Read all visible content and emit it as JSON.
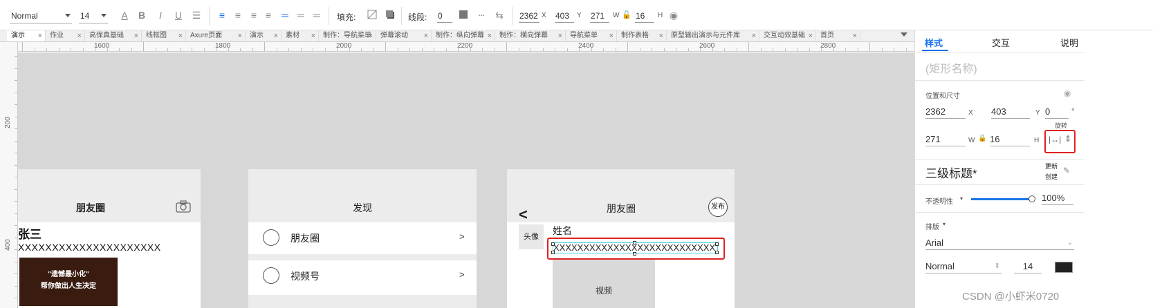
{
  "toolbar": {
    "style_value": "Normal",
    "font_size_value": "14",
    "fill_label": "填充:",
    "stroke_label": "线段:",
    "stroke_value": "0",
    "x_value": "2362",
    "x_unit": "X",
    "y_value": "403",
    "y_unit": "Y",
    "w_value": "271",
    "w_unit": "W",
    "h_value": "16",
    "h_unit": "H"
  },
  "tabs": [
    {
      "label": "演示",
      "active": true
    },
    {
      "label": "作业"
    },
    {
      "label": "高保真基础"
    },
    {
      "label": "线框图"
    },
    {
      "label": "Axure页面"
    },
    {
      "label": "演示"
    },
    {
      "label": "素材"
    },
    {
      "label": "制作：导航菜单"
    },
    {
      "label": "弹幕滚动"
    },
    {
      "label": "制作：纵向弹幕"
    },
    {
      "label": "制作：横向弹幕"
    },
    {
      "label": "导航菜单"
    },
    {
      "label": "制作表格"
    },
    {
      "label": "原型输出演示与元件库"
    },
    {
      "label": "交互动效基础"
    },
    {
      "label": "首页"
    }
  ],
  "ruler": {
    "h_labels": [
      "1600",
      "1800",
      "2000",
      "2200",
      "2400",
      "2600",
      "2800"
    ],
    "v_labels": [
      "200",
      "400"
    ]
  },
  "canvas": {
    "phone1": {
      "title": "朋友圈",
      "name": "张三",
      "text": "XXXXXXXXXXXXXXXXXXXXX",
      "img_line1": "\"遗憾最小化\"",
      "img_line2": "帮你做出人生决定"
    },
    "phone2": {
      "title": "发现",
      "items": [
        {
          "label": "朋友圈",
          "arrow": ">"
        },
        {
          "label": "视频号",
          "arrow": ">"
        }
      ]
    },
    "phone3": {
      "back": "<",
      "title": "朋友圈",
      "publish": "发布",
      "avatar": "头像",
      "name": "姓名",
      "text": "XXXXXXXXXXXXXXXXXXXXXXXXXXX",
      "media": "视频"
    }
  },
  "panel": {
    "tabs": [
      "样式",
      "交互",
      "说明"
    ],
    "shape_name_placeholder": "(矩形名称)",
    "pos_size_label": "位置和尺寸",
    "x_value": "2362",
    "x_unit": "X",
    "y_value": "403",
    "y_unit": "Y",
    "rotation_value": "0",
    "rotation_unit": "°",
    "rotation_label": "旋转",
    "w_value": "271",
    "w_unit": "W",
    "h_value": "16",
    "h_unit": "H",
    "style_name": "三级标题*",
    "update_label_1": "更新",
    "update_label_2": "创建",
    "opacity_label": "不透明性",
    "opacity_value": "100%",
    "opacity": 1.0,
    "typography_label": "排版",
    "font_value": "Arial",
    "weight_value": "Normal",
    "size_value": "14",
    "watermark": "CSDN @小虾米0720"
  },
  "colors": {
    "accent": "#1a73e8",
    "highlight": "#e02020",
    "canvas_bg": "#d7d7d7",
    "header_gray": "#ececec"
  }
}
